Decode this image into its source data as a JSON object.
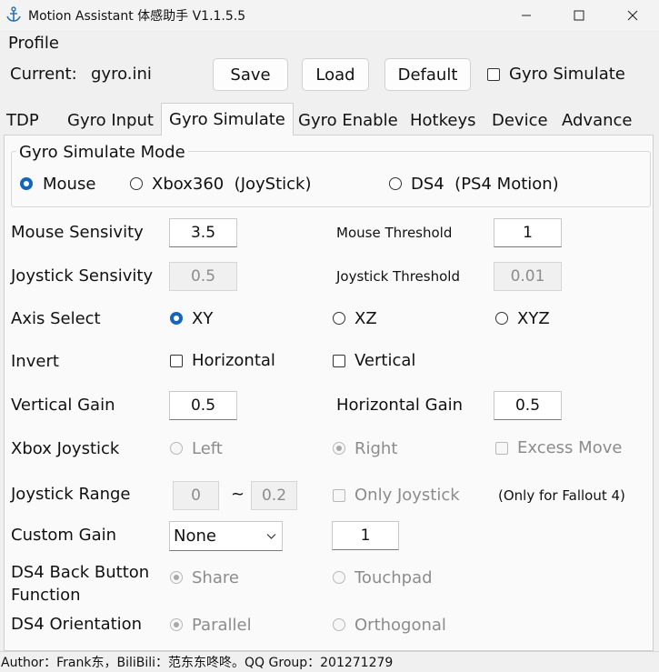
{
  "window": {
    "title": "Motion Assistant 体感助手 V1.1.5.5"
  },
  "profile": {
    "section_label": "Profile",
    "current_label": "Current:",
    "current_value": "gyro.ini",
    "save_label": "Save",
    "load_label": "Load",
    "default_label": "Default",
    "gyro_simulate_label": "Gyro Simulate",
    "gyro_simulate_checked": false
  },
  "tabs": [
    {
      "label": "TDP"
    },
    {
      "label": "Gyro Input"
    },
    {
      "label": "Gyro Simulate",
      "active": true
    },
    {
      "label": "Gyro Enable"
    },
    {
      "label": "Hotkeys"
    },
    {
      "label": "Device"
    },
    {
      "label": "Advance"
    }
  ],
  "mode": {
    "group_label": "Gyro Simulate Mode",
    "options": [
      {
        "label": "Mouse",
        "selected": true
      },
      {
        "label": "Xbox360  (JoyStick)",
        "selected": false
      },
      {
        "label": "DS4  (PS4 Motion)",
        "selected": false
      }
    ]
  },
  "settings": {
    "mouse_sensivity_label": "Mouse Sensivity",
    "mouse_sensivity_value": "3.5",
    "mouse_threshold_label": "Mouse Threshold",
    "mouse_threshold_value": "1",
    "joystick_sensivity_label": "Joystick Sensivity",
    "joystick_sensivity_value": "0.5",
    "joystick_threshold_label": "Joystick Threshold",
    "joystick_threshold_value": "0.01",
    "axis_select_label": "Axis Select",
    "axis_options": [
      {
        "label": "XY",
        "selected": true
      },
      {
        "label": "XZ",
        "selected": false
      },
      {
        "label": "XYZ",
        "selected": false
      }
    ],
    "invert_label": "Invert",
    "invert_horizontal_label": "Horizontal",
    "invert_vertical_label": "Vertical",
    "vertical_gain_label": "Vertical Gain",
    "vertical_gain_value": "0.5",
    "horizontal_gain_label": "Horizontal Gain",
    "horizontal_gain_value": "0.5",
    "xbox_joystick_label": "Xbox Joystick",
    "xbox_left_label": "Left",
    "xbox_right_label": "Right",
    "xbox_right_selected": true,
    "excess_move_label": "Excess Move",
    "joystick_range_label": "Joystick Range",
    "joystick_range_min": "0",
    "joystick_range_sep": "~",
    "joystick_range_max": "0.2",
    "only_joystick_label": "Only Joystick",
    "only_fallout_note": "(Only for Fallout 4)",
    "custom_gain_label": "Custom Gain",
    "custom_gain_selected": "None",
    "custom_gain_value": "1",
    "ds4_back_label_line1": "DS4 Back Button",
    "ds4_back_label_line2": "Function",
    "ds4_share_label": "Share",
    "ds4_share_selected": true,
    "ds4_touchpad_label": "Touchpad",
    "ds4_orientation_label": "DS4 Orientation",
    "ds4_parallel_label": "Parallel",
    "ds4_parallel_selected": true,
    "ds4_orthogonal_label": "Orthogonal"
  },
  "status_bar": {
    "text": "Author：Frank东，BiliBili：范东东咚咚。QQ Group：201271279"
  },
  "colors": {
    "accent": "#1565c0",
    "panel_bg": "#fafafa",
    "window_bg": "#f0f0f0"
  }
}
